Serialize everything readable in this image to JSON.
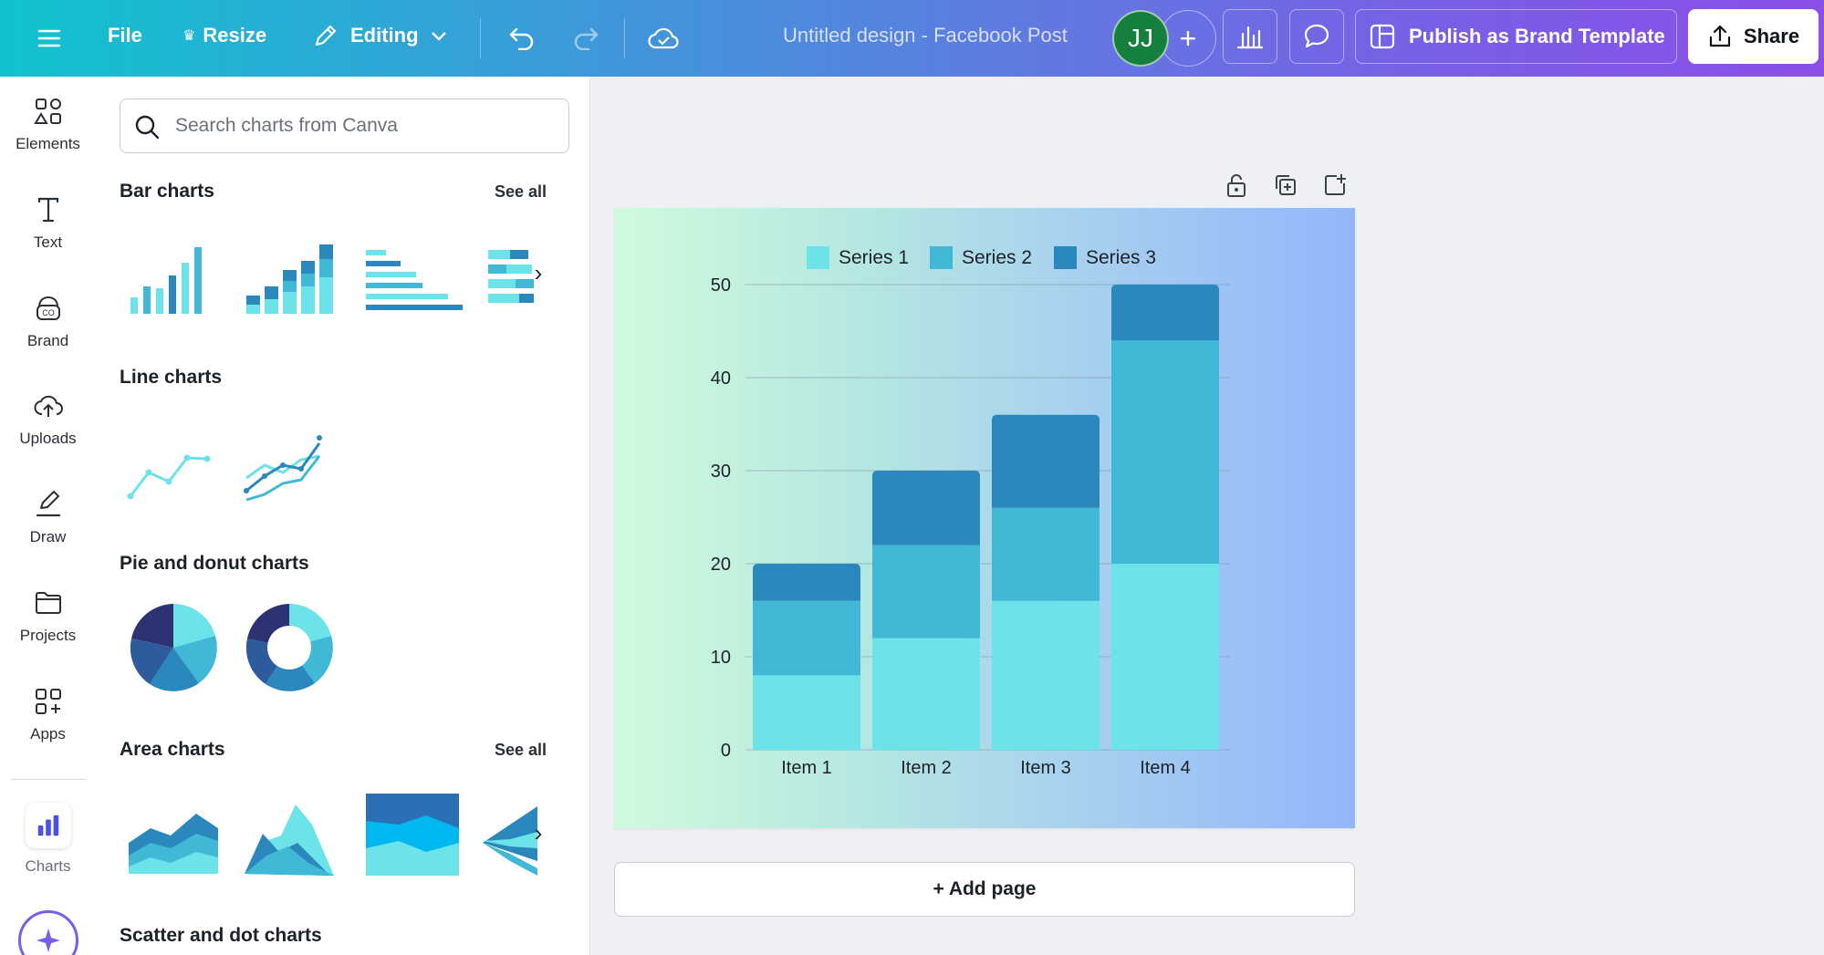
{
  "topbar": {
    "file_label": "File",
    "resize_label": "Resize",
    "editing_label": "Editing",
    "doc_title": "Untitled design - Facebook Post",
    "avatar_initials": "JJ",
    "publish_label": "Publish as Brand Template",
    "share_label": "Share"
  },
  "rail": {
    "items": [
      {
        "label": "Elements",
        "icon": "shapes-icon"
      },
      {
        "label": "Text",
        "icon": "text-icon"
      },
      {
        "label": "Brand",
        "icon": "brand-icon"
      },
      {
        "label": "Uploads",
        "icon": "upload-cloud-icon"
      },
      {
        "label": "Draw",
        "icon": "pen-icon"
      },
      {
        "label": "Projects",
        "icon": "folder-icon"
      },
      {
        "label": "Apps",
        "icon": "apps-icon"
      },
      {
        "label": "Charts",
        "icon": "bar-chart-icon"
      }
    ]
  },
  "panel": {
    "search_placeholder": "Search charts from Canva",
    "sections": {
      "bar": {
        "title": "Bar charts",
        "see_all": "See all"
      },
      "line": {
        "title": "Line charts"
      },
      "pie": {
        "title": "Pie and donut charts"
      },
      "area": {
        "title": "Area charts",
        "see_all": "See all"
      },
      "scatter": {
        "title": "Scatter and dot charts"
      }
    }
  },
  "canvas": {
    "add_page_label": "+ Add page"
  },
  "colors": {
    "series1": "#6ce3e8",
    "series2": "#41b8d6",
    "series3": "#2b88bd",
    "accent_purple": "#7a5ee6",
    "avatar_green": "#15803d"
  },
  "chart_data": {
    "type": "bar",
    "stacked": true,
    "categories": [
      "Item 1",
      "Item 2",
      "Item 3",
      "Item 4"
    ],
    "series": [
      {
        "name": "Series 1",
        "values": [
          8,
          12,
          16,
          20
        ]
      },
      {
        "name": "Series 2",
        "values": [
          8,
          10,
          10,
          24
        ]
      },
      {
        "name": "Series 3",
        "values": [
          4,
          8,
          10,
          6
        ]
      }
    ],
    "ylim": [
      0,
      50
    ],
    "yticks": [
      0,
      10,
      20,
      30,
      40,
      50
    ],
    "grid": true,
    "legend_position": "top"
  }
}
